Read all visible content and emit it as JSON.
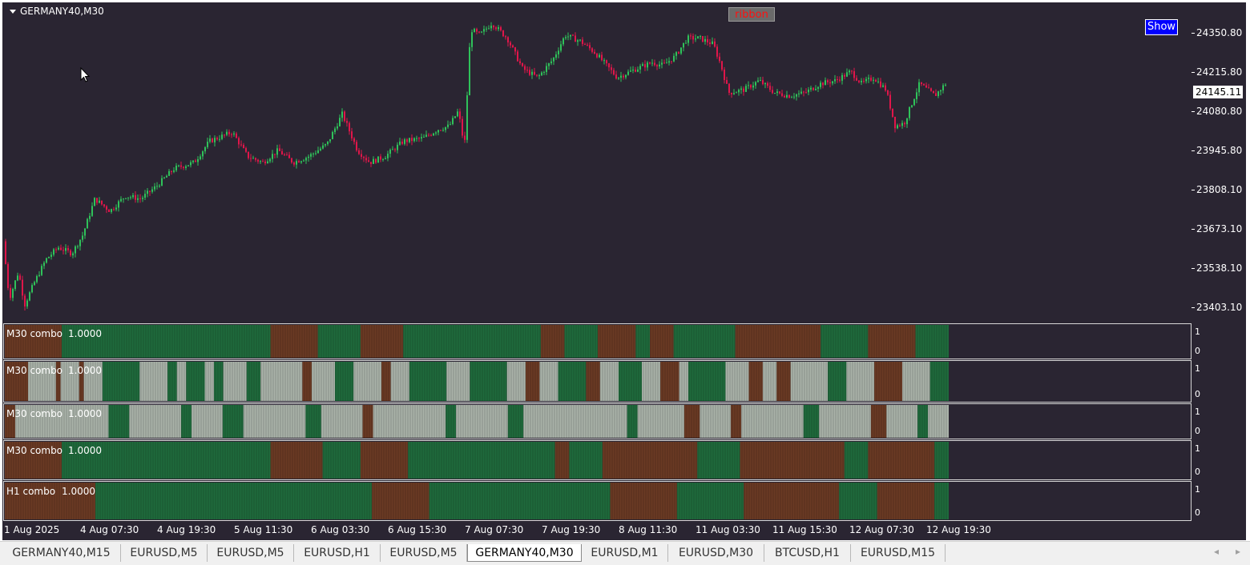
{
  "chart": {
    "symbol_title": "GERMANY40,M30",
    "ribbon_label": "ribbon",
    "show_button": "Show",
    "current_price": "24145.11",
    "price_ticks": [
      "24350.80",
      "24215.80",
      "24080.80",
      "23945.80",
      "23808.10",
      "23673.10",
      "23538.10",
      "23403.10"
    ],
    "price_range": [
      23360,
      24400
    ],
    "colors": {
      "background": "#2a2532",
      "bull": "#2fc25a",
      "bear": "#e0164a",
      "green_block": "#1f6a3c",
      "brown_block": "#6a3a24",
      "grey_block": "#a9b2a8"
    },
    "time_labels": [
      "1 Aug 2025",
      "4 Aug 07:30",
      "4 Aug 19:30",
      "5 Aug 11:30",
      "6 Aug 03:30",
      "6 Aug 15:30",
      "7 Aug 07:30",
      "7 Aug 19:30",
      "8 Aug 11:30",
      "11 Aug 03:30",
      "11 Aug 15:30",
      "12 Aug 07:30",
      "12 Aug 19:30"
    ],
    "candles_waypoints": [
      [
        0,
        23620
      ],
      [
        4,
        23430
      ],
      [
        10,
        23520
      ],
      [
        14,
        23410
      ],
      [
        20,
        23480
      ],
      [
        28,
        23560
      ],
      [
        36,
        23600
      ],
      [
        45,
        23580
      ],
      [
        52,
        23640
      ],
      [
        60,
        23760
      ],
      [
        70,
        23720
      ],
      [
        80,
        23770
      ],
      [
        90,
        23760
      ],
      [
        100,
        23800
      ],
      [
        112,
        23860
      ],
      [
        125,
        23880
      ],
      [
        135,
        23950
      ],
      [
        150,
        23980
      ],
      [
        160,
        23900
      ],
      [
        170,
        23880
      ],
      [
        180,
        23920
      ],
      [
        190,
        23880
      ],
      [
        200,
        23900
      ],
      [
        212,
        23940
      ],
      [
        222,
        24040
      ],
      [
        232,
        23920
      ],
      [
        240,
        23880
      ],
      [
        250,
        23900
      ],
      [
        262,
        23950
      ],
      [
        275,
        23960
      ],
      [
        285,
        23990
      ],
      [
        292,
        24000
      ],
      [
        298,
        24050
      ],
      [
        302,
        23930
      ],
      [
        306,
        24320
      ],
      [
        312,
        24300
      ],
      [
        320,
        24340
      ],
      [
        330,
        24290
      ],
      [
        340,
        24190
      ],
      [
        350,
        24160
      ],
      [
        360,
        24220
      ],
      [
        368,
        24300
      ],
      [
        378,
        24280
      ],
      [
        388,
        24240
      ],
      [
        395,
        24200
      ],
      [
        402,
        24160
      ],
      [
        415,
        24190
      ],
      [
        425,
        24210
      ],
      [
        432,
        24200
      ],
      [
        440,
        24230
      ],
      [
        448,
        24290
      ],
      [
        456,
        24290
      ],
      [
        465,
        24270
      ],
      [
        470,
        24200
      ],
      [
        475,
        24110
      ],
      [
        485,
        24120
      ],
      [
        495,
        24150
      ],
      [
        505,
        24110
      ],
      [
        515,
        24100
      ],
      [
        525,
        24110
      ],
      [
        535,
        24140
      ],
      [
        545,
        24150
      ],
      [
        555,
        24180
      ],
      [
        562,
        24140
      ],
      [
        570,
        24160
      ],
      [
        578,
        24120
      ],
      [
        584,
        24000
      ],
      [
        590,
        24010
      ],
      [
        600,
        24140
      ],
      [
        610,
        24100
      ],
      [
        617,
        24140
      ]
    ]
  },
  "indicators": [
    {
      "label": "M30 combo",
      "value": "1.0000",
      "tick_top": "1",
      "tick_bottom": "0",
      "blocks": [
        [
          "b",
          12
        ],
        [
          "g",
          44
        ],
        [
          "b",
          10
        ],
        [
          "g",
          9
        ],
        [
          "b",
          9
        ],
        [
          "g",
          29
        ],
        [
          "b",
          5
        ],
        [
          "g",
          7
        ],
        [
          "b",
          8
        ],
        [
          "g",
          3
        ],
        [
          "b",
          5
        ],
        [
          "g",
          13
        ],
        [
          "b",
          18
        ],
        [
          "g",
          10
        ],
        [
          "b",
          10
        ],
        [
          "g",
          7
        ]
      ]
    },
    {
      "label": "M30 combo",
      "value": "1.0000",
      "tick_top": "1",
      "tick_bottom": "0",
      "blocks": [
        [
          "b",
          5
        ],
        [
          "x",
          6
        ],
        [
          "b",
          1
        ],
        [
          "x",
          4
        ],
        [
          "b",
          1
        ],
        [
          "x",
          4
        ],
        [
          "g",
          8
        ],
        [
          "x",
          6
        ],
        [
          "g",
          2
        ],
        [
          "x",
          2
        ],
        [
          "g",
          4
        ],
        [
          "x",
          2
        ],
        [
          "g",
          2
        ],
        [
          "x",
          5
        ],
        [
          "g",
          3
        ],
        [
          "x",
          9
        ],
        [
          "b",
          2
        ],
        [
          "x",
          5
        ],
        [
          "g",
          4
        ],
        [
          "x",
          6
        ],
        [
          "b",
          2
        ],
        [
          "x",
          4
        ],
        [
          "g",
          8
        ],
        [
          "x",
          5
        ],
        [
          "g",
          8
        ],
        [
          "x",
          4
        ],
        [
          "b",
          3
        ],
        [
          "x",
          4
        ],
        [
          "g",
          6
        ],
        [
          "b",
          3
        ],
        [
          "x",
          4
        ],
        [
          "g",
          5
        ],
        [
          "x",
          4
        ],
        [
          "b",
          4
        ],
        [
          "x",
          2
        ],
        [
          "g",
          8
        ],
        [
          "x",
          5
        ],
        [
          "b",
          3
        ],
        [
          "x",
          3
        ],
        [
          "b",
          3
        ],
        [
          "x",
          8
        ],
        [
          "g",
          4
        ],
        [
          "x",
          6
        ],
        [
          "b",
          6
        ],
        [
          "x",
          6
        ],
        [
          "g",
          4
        ]
      ]
    },
    {
      "label": "M30 combo",
      "value": "1.0000",
      "tick_top": "1",
      "tick_bottom": "0",
      "blocks": [
        [
          "b",
          2
        ],
        [
          "x",
          18
        ],
        [
          "g",
          4
        ],
        [
          "x",
          10
        ],
        [
          "g",
          2
        ],
        [
          "x",
          6
        ],
        [
          "g",
          4
        ],
        [
          "x",
          12
        ],
        [
          "g",
          3
        ],
        [
          "x",
          8
        ],
        [
          "b",
          2
        ],
        [
          "x",
          14
        ],
        [
          "g",
          2
        ],
        [
          "x",
          10
        ],
        [
          "g",
          3
        ],
        [
          "x",
          20
        ],
        [
          "g",
          2
        ],
        [
          "x",
          9
        ],
        [
          "b",
          3
        ],
        [
          "x",
          6
        ],
        [
          "b",
          2
        ],
        [
          "x",
          12
        ],
        [
          "g",
          3
        ],
        [
          "x",
          10
        ],
        [
          "b",
          3
        ],
        [
          "x",
          6
        ],
        [
          "g",
          2
        ],
        [
          "x",
          4
        ]
      ]
    },
    {
      "label": "M30 combo",
      "value": "1.0000",
      "tick_top": "1",
      "tick_bottom": "0",
      "blocks": [
        [
          "b",
          12
        ],
        [
          "g",
          44
        ],
        [
          "b",
          11
        ],
        [
          "g",
          8
        ],
        [
          "b",
          10
        ],
        [
          "g",
          31
        ],
        [
          "b",
          3
        ],
        [
          "g",
          7
        ],
        [
          "b",
          20
        ],
        [
          "g",
          9
        ],
        [
          "b",
          22
        ],
        [
          "g",
          5
        ],
        [
          "b",
          14
        ],
        [
          "g",
          3
        ]
      ]
    },
    {
      "label": "H1 combo",
      "value": "1.0000",
      "tick_top": "1",
      "tick_bottom": "0",
      "blocks": [
        [
          "b",
          19
        ],
        [
          "g",
          58
        ],
        [
          "b",
          12
        ],
        [
          "g",
          38
        ],
        [
          "b",
          14
        ],
        [
          "g",
          14
        ],
        [
          "b",
          20
        ],
        [
          "g",
          8
        ],
        [
          "b",
          12
        ],
        [
          "g",
          3
        ]
      ]
    }
  ],
  "tabs": [
    "GERMANY40,M15",
    "EURUSD,M5",
    "EURUSD,M5",
    "EURUSD,H1",
    "EURUSD,M5",
    "GERMANY40,M30",
    "EURUSD,M1",
    "EURUSD,M30",
    "BTCUSD,H1",
    "EURUSD,M15"
  ],
  "active_tab": 5,
  "scroll": {
    "left": "◂",
    "right": "▸"
  }
}
